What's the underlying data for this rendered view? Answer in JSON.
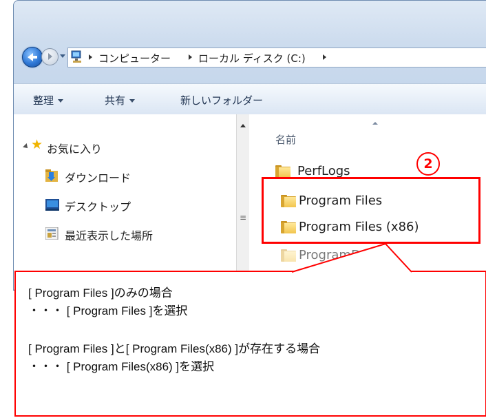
{
  "address_bar": {
    "breadcrumbs": [
      "コンピューター",
      "ローカル ディスク (C:)"
    ]
  },
  "toolbar": {
    "organize": "整理",
    "share": "共有",
    "new_folder": "新しいフォルダー"
  },
  "nav_pane": {
    "favorites": "お気に入り",
    "items": [
      "ダウンロード",
      "デスクトップ",
      "最近表示した場所"
    ]
  },
  "content": {
    "column_name": "名前",
    "files": [
      "PerfLogs",
      "Program Files",
      "Program Files (x86)",
      "ProgramData"
    ]
  },
  "annotation": {
    "badge": "2",
    "lines": [
      "[ Program Files ]のみの場合",
      "・・・ [ Program Files ]を選択",
      "[ Program Files ]と[ Program Files(x86) ]が存在する場合",
      "・・・ [ Program Files(x86) ]を選択"
    ],
    "color": "#ff0000"
  }
}
